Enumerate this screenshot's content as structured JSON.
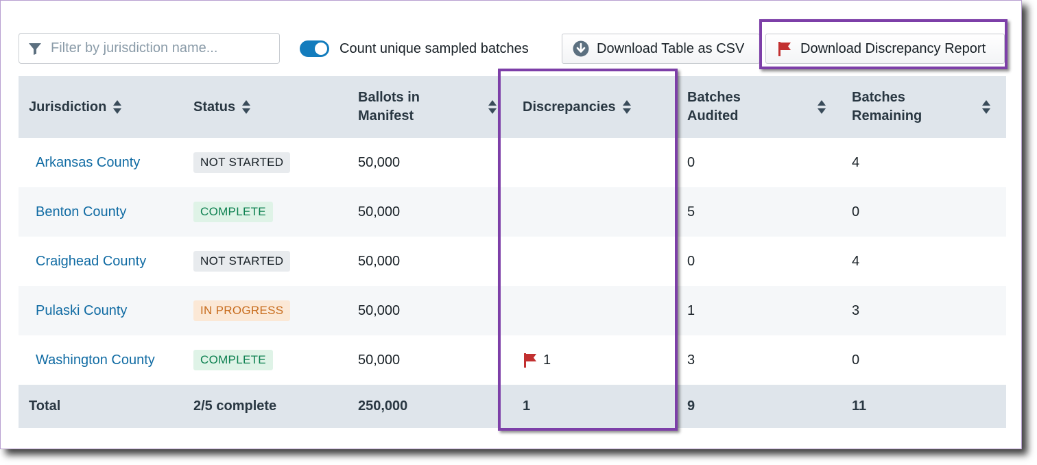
{
  "toolbar": {
    "filter_placeholder": "Filter by jurisdiction name...",
    "filter_icon": "filter-icon",
    "toggle_label": "Count unique sampled batches",
    "toggle_on": true,
    "download_csv_label": "Download Table as CSV",
    "download_csv_icon": "download-circle-icon",
    "download_discrepancy_label": "Download Discrepancy Report",
    "download_discrepancy_icon": "flag-icon"
  },
  "table": {
    "headers": [
      {
        "line1": "Jurisdiction",
        "line2": ""
      },
      {
        "line1": "Status",
        "line2": ""
      },
      {
        "line1": "Ballots in",
        "line2": "Manifest"
      },
      {
        "line1": "Discrepancies",
        "line2": ""
      },
      {
        "line1": "Batches",
        "line2": "Audited"
      },
      {
        "line1": "Batches",
        "line2": "Remaining"
      }
    ],
    "rows": [
      {
        "jurisdiction": "Arkansas County",
        "status": "NOT STARTED",
        "ballots": "50,000",
        "discrepancies": "",
        "audited": "0",
        "remaining": "4"
      },
      {
        "jurisdiction": "Benton County",
        "status": "COMPLETE",
        "ballots": "50,000",
        "discrepancies": "",
        "audited": "5",
        "remaining": "0"
      },
      {
        "jurisdiction": "Craighead County",
        "status": "NOT STARTED",
        "ballots": "50,000",
        "discrepancies": "",
        "audited": "0",
        "remaining": "4"
      },
      {
        "jurisdiction": "Pulaski County",
        "status": "IN PROGRESS",
        "ballots": "50,000",
        "discrepancies": "",
        "audited": "1",
        "remaining": "3"
      },
      {
        "jurisdiction": "Washington County",
        "status": "COMPLETE",
        "ballots": "50,000",
        "discrepancies": "1",
        "audited": "3",
        "remaining": "0"
      }
    ],
    "total": {
      "label": "Total",
      "status": "2/5 complete",
      "ballots": "250,000",
      "discrepancies": "1",
      "audited": "9",
      "remaining": "11"
    }
  },
  "colors": {
    "accent": "#137cbd",
    "link": "#106ba3",
    "flag": "#c23030",
    "highlight": "#7d3fa8",
    "header_bg": "#dfe5eb",
    "status_complete": "#0d8050",
    "status_in_progress": "#c76b1c"
  }
}
